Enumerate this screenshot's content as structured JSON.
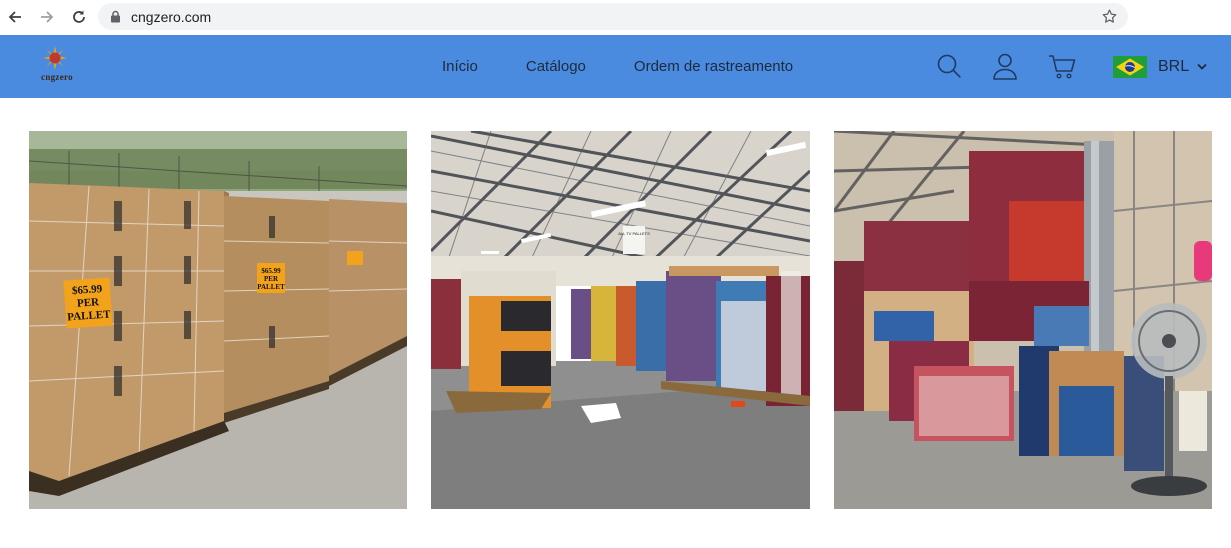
{
  "browser": {
    "url": "cngzero.com",
    "icons": [
      "back-arrow-icon",
      "forward-arrow-icon",
      "reload-icon",
      "lock-icon",
      "bookmark-star-icon"
    ]
  },
  "header": {
    "logo_text": "cngzero",
    "nav": [
      {
        "label": "Início"
      },
      {
        "label": "Catálogo"
      },
      {
        "label": "Ordem de rastreamento"
      }
    ],
    "icons": [
      "search-icon",
      "account-icon",
      "cart-icon"
    ],
    "currency": {
      "flag": "brazil-flag-icon",
      "label": "BRL"
    },
    "bg_color": "#4a8be0"
  },
  "gallery": {
    "tiles": [
      {
        "name": "pallets-outdoor-image",
        "sign_line1": "$65.99",
        "sign_line2": "PER",
        "sign_line3": "PALLET",
        "sign2_line1": "$65.99",
        "sign2_line2": "PER",
        "sign2_line3": "PALLET"
      },
      {
        "name": "warehouse-aisle-image",
        "sign_text": "ALL TV PALLETS"
      },
      {
        "name": "warehouse-stacks-image"
      }
    ]
  }
}
